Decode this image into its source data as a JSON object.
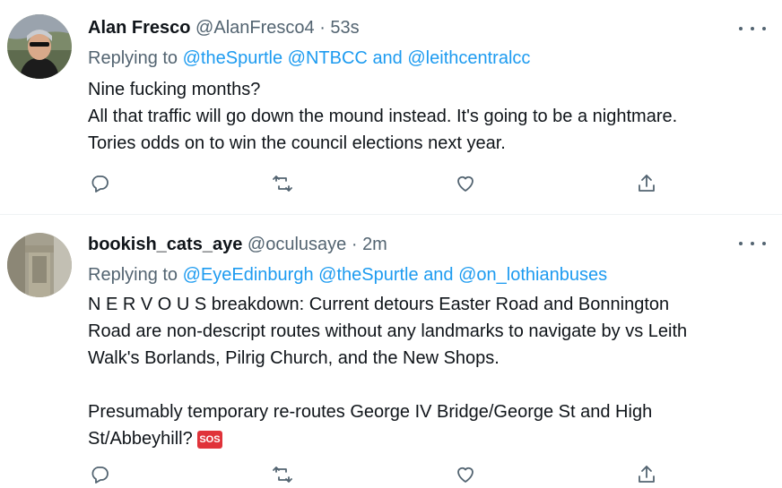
{
  "tweets": [
    {
      "display_name": "Alan Fresco",
      "handle": "@AlanFresco4",
      "separator": "·",
      "time": "53s",
      "replying_prefix": "Replying to",
      "mentions": [
        "@theSpurtle",
        "@NTBCC"
      ],
      "and_text": "and",
      "last_mention": "@leithcentralcc",
      "body_lines": [
        "Nine fucking months?",
        "All that traffic will go down the mound instead. It's going to be a nightmare.",
        "Tories odds on to win the council elections next year."
      ],
      "icons": {
        "more": "more-icon",
        "reply": "reply-icon",
        "retweet": "retweet-icon",
        "like": "like-icon",
        "share": "share-icon"
      }
    },
    {
      "display_name": "bookish_cats_aye",
      "handle": "@oculusaye",
      "separator": "·",
      "time": "2m",
      "replying_prefix": "Replying to",
      "mentions": [
        "@EyeEdinburgh",
        "@theSpurtle"
      ],
      "and_text": "and",
      "last_mention": "@on_lothianbuses",
      "body_lines": [
        "N E R V O U S breakdown: Current detours Easter Road and Bonnington",
        "Road are non-descript routes without any landmarks to navigate by vs Leith",
        "Walk's Borlands, Pilrig Church, and the New Shops."
      ],
      "body_lines_2": [
        "Presumably temporary re-routes George IV Bridge/George St and High",
        "St/Abbeyhill?"
      ],
      "emoji": "SOS",
      "icons": {
        "more": "more-icon",
        "reply": "reply-icon",
        "retweet": "retweet-icon",
        "like": "like-icon",
        "share": "share-icon"
      }
    }
  ],
  "colors": {
    "text": "#0f1419",
    "secondary": "#536471",
    "link": "#1d9bf0",
    "divider": "#eff3f4",
    "sos": "#e0333a"
  }
}
